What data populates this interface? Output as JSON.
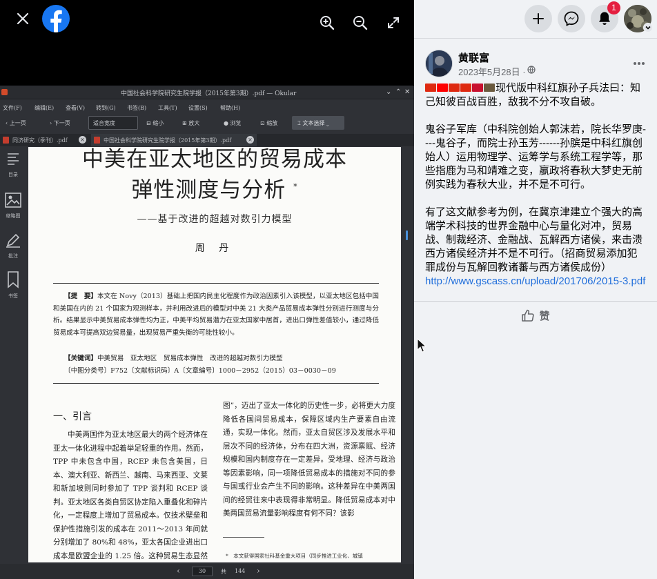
{
  "viewer": {
    "close_icon": "close-icon",
    "logo_icon": "facebook-logo",
    "zoom_in_icon": "zoom-in-icon",
    "zoom_out_icon": "zoom-out-icon",
    "fullscreen_icon": "fullscreen-icon"
  },
  "okular": {
    "title": "中国社会科学院研究生院学报（2015年第3期）.pdf — Okular",
    "menus": [
      "文件(F)",
      "编辑(E)",
      "查看(V)",
      "转到(G)",
      "书签(B)",
      "工具(T)",
      "设置(S)",
      "帮助(H)"
    ],
    "toolbar": {
      "prev": "上一页",
      "next": "下一页",
      "zoom": "适合宽度",
      "zoom_in": "缩小",
      "zoom_out": "放大",
      "browse": "浏览",
      "zoom_tool": "缩放",
      "select": "文本选择"
    },
    "tabs": [
      "同济研究（季刊）.pdf",
      "中国社会科学院研究生院学报（2015年第3期）.pdf"
    ],
    "sidebar": [
      "目录",
      "缩略图",
      "批注",
      "书签"
    ],
    "page_current": "30",
    "page_of": "共",
    "page_total": "144"
  },
  "pdf": {
    "title_line1": "中美在亚太地区的贸易成本",
    "title_line2": "弹性测度与分析",
    "title_mark": "*",
    "subtitle": "——基于改进的超越对数引力模型",
    "author": "周 丹",
    "abstract_label": "【提　要】",
    "abstract": "本文在 Novy（2013）基础上把国内民主化程度作为政治因素引入该模型，以亚太地区包括中国和美国在内的 21 个国家为观测样本，并利用改进后的模型对中美 21 大类产品贸易成本弹性分别进行测度与分析。结果显示中美贸易成本弹性均为正，中美平均贸易潜力在亚太国家中居首，进出口弹性差值较小，通过降低贸易成本可提高双边贸易量，出现贸易严重失衡的可能性较小。",
    "keywords_label": "【关键词】",
    "keywords": "中美贸易　亚太地区　贸易成本弹性　改进的超越对数引力模型",
    "classnum": "〔中图分类号〕F752〔文献标识码〕A〔文章编号〕1000－2952（2015）03－0030－09",
    "section_title": "一、引言",
    "col1": "中美两国作为亚太地区最大的两个经济体在亚太一体化进程中起着举足轻重的作用。然而，TPP 中未包含中国，RCEP 未包含美国，日本、澳大利亚、新西兰、越南、马来西亚、文莱和新加坡则同时参加了 TPP 谈判和 RCEP 谈判。亚太地区各类自贸区协定陷入重叠化和碎片化，一定程度上增加了贸易成本。仅技术壁垒和保护性措施引发的成本在 2011～2013 年间就分别增加了 80%和 48%，亚太各国企业进出口成本是欧盟企业的 1.25 倍。这种贸易生态显然与亚太一体化之宗旨相悖。",
    "col2": "图”，迈出了亚太一体化的历史性一步，必将更大力度降低各国间贸易成本，保障区域内生产要素自由流通，实现一体化。然而，亚太自贸区涉及发展水平和层次不同的经济体，分布在四大洲，资源禀赋、经济规模和国内制度存在一定差异。受地理、经济与政治等因素影响，同一项降低贸易成本的措施对不同的参与国或行业会产生不同的影响。这种差异在中美两国间的经贸往来中表现得非常明显。降低贸易成本对中美两国贸易流量影响程度有何不同？该影",
    "footnote": "*　本文获得国家社科基金重大项目（同步推进工业化、城镇"
  },
  "topbar": {
    "create_icon": "plus-icon",
    "messenger_icon": "messenger-icon",
    "notifications_icon": "bell-icon",
    "notification_count": "1",
    "account_caret_icon": "chevron-down-icon"
  },
  "post": {
    "author": "黄联富",
    "date": "2023年5月28日 ·",
    "audience_icon": "globe-icon",
    "menu_icon": "more-icon",
    "flags": [
      "#de2910",
      "#fe0000",
      "#de2910",
      "#de2910",
      "#c8102e",
      "#6b5a3e"
    ],
    "para1": "现代版中科红旗孙子兵法曰：知己知彼百战百胜，敌我不分不攻自破。",
    "para2": "鬼谷子军库（中科院创始人郭沫若，院长华罗庚----鬼谷子，而院士孙玉芳------孙膑是中科红旗创始人）运用物理学、运筹学与系统工程学等，那些指鹿为马和靖难之变，嬴政将春秋大梦史无前例实践为春秋大业，并不是不可行。",
    "para3": "有了这文献参考为例，在冀京津建立个强大的高端学术科技的世界金融中心与量化对冲，贸易战、制裁经济、金融战、瓦解西方诸侯，来击溃西方诸侯经济并不是不可行。（招商贸易添加犯罪成份与瓦解回教诸蕃与西方诸侯成份）",
    "link": "http://www.gscass.cn/upload/201706/2015-3.pdf",
    "like_label": "赞",
    "like_icon": "thumbs-up-icon"
  },
  "colors": {
    "facebook_blue": "#1877f2",
    "link": "#216fdb",
    "badge_red": "#e41e3f",
    "panel_bg": "#f0f2f5"
  }
}
